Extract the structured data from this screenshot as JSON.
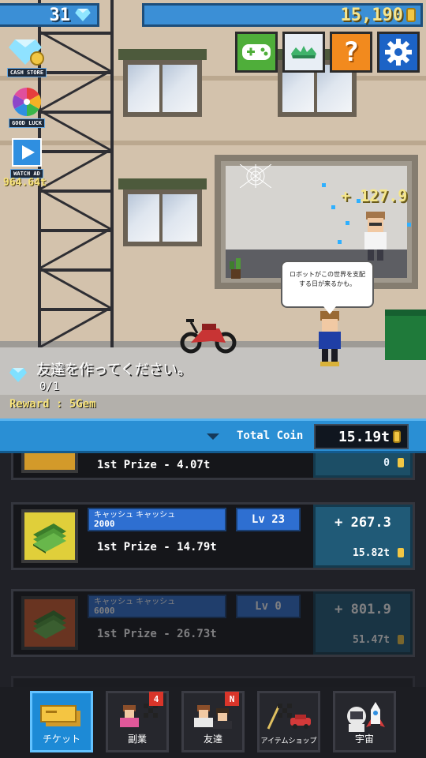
{
  "hud": {
    "gems": "31",
    "coins": "15,190"
  },
  "side_menu": {
    "cash_store": "CASH STORE",
    "good_luck": "GOOD LUCK",
    "watch_ad": "WATCH AD",
    "ad_reward": "964.64t"
  },
  "scene": {
    "float_value": "+ 127.9",
    "speech": "ロボットがこの世界を支配する日が来るかも。"
  },
  "quest": {
    "title": "友達を作ってください。",
    "progress": "0/1",
    "reward": "Reward : 5Gem"
  },
  "total": {
    "label": "Total Coin",
    "value": "15.19t"
  },
  "list": {
    "rows": [
      {
        "prize": "1st Prize - 4.07t",
        "sub": "0"
      },
      {
        "name": "キャッシュ キャッシュ",
        "price": "2000",
        "level": "Lv 23",
        "prize": "1st Prize - 14.79t",
        "plus": "+ 267.3",
        "sub": "15.82t"
      },
      {
        "name": "キャッシュ キャッシュ",
        "price": "6000",
        "level": "Lv 0",
        "prize": "1st Prize - 26.73t",
        "plus": "+ 801.9",
        "sub": "51.47t"
      }
    ]
  },
  "nav": {
    "items": [
      {
        "label": "チケット"
      },
      {
        "label": "副業",
        "badge": "4"
      },
      {
        "label": "友達",
        "badge": "N"
      },
      {
        "label": "アイテムショップ"
      },
      {
        "label": "宇宙"
      }
    ]
  },
  "colors": {
    "hud_blue": "#3b8fd6",
    "gold": "#f6e27a",
    "active_tab": "#1d8ad6",
    "badge_red": "#d9352a"
  }
}
